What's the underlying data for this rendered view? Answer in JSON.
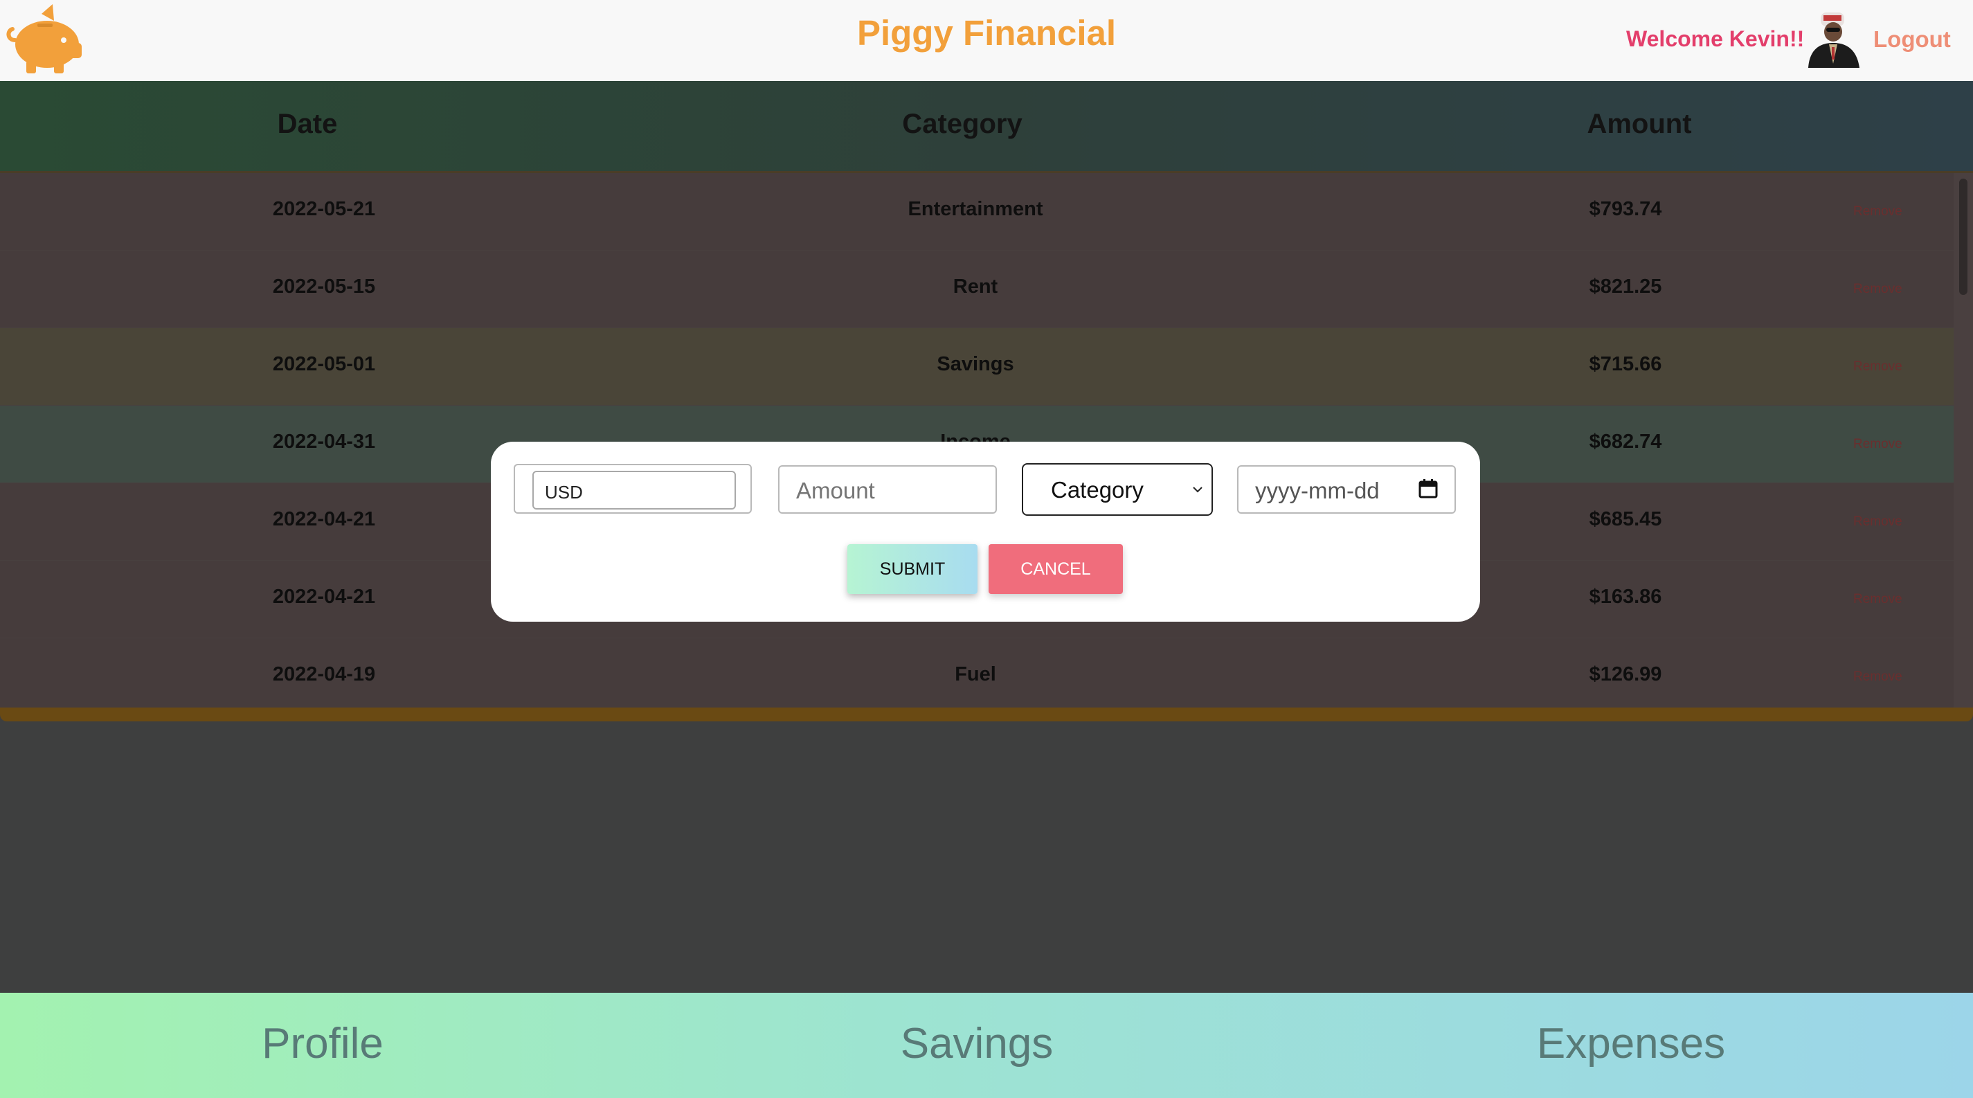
{
  "header": {
    "title": "Piggy Financial",
    "welcome": "Welcome Kevin!!",
    "logout": "Logout",
    "logo_icon": "piggy-bank-icon",
    "avatar_icon": "user-avatar"
  },
  "table": {
    "columns": [
      "Date",
      "Category",
      "Amount"
    ],
    "rows": [
      {
        "date": "2022-05-21",
        "category": "Entertainment",
        "amount": "$793.74",
        "action": "Remove",
        "color": "#463c3c"
      },
      {
        "date": "2022-05-15",
        "category": "Rent",
        "amount": "$821.25",
        "action": "Remove",
        "color": "#463c3c"
      },
      {
        "date": "2022-05-01",
        "category": "Savings",
        "amount": "$715.66",
        "action": "Remove",
        "color": "#4a4538"
      },
      {
        "date": "2022-04-31",
        "category": "Income",
        "amount": "$682.74",
        "action": "Remove",
        "color": "#3f4b44"
      },
      {
        "date": "2022-04-21",
        "category": "",
        "amount": "$685.45",
        "action": "Remove",
        "color": "#463c3c"
      },
      {
        "date": "2022-04-21",
        "category": "",
        "amount": "$163.86",
        "action": "Remove",
        "color": "#463c3c"
      },
      {
        "date": "2022-04-19",
        "category": "Fuel",
        "amount": "$126.99",
        "action": "Remove",
        "color": "#463c3c"
      }
    ]
  },
  "modal": {
    "currency_value": "USD",
    "amount_placeholder": "Amount",
    "category_selected": "Category",
    "date_placeholder": "yyyy-mm-dd",
    "submit_label": "SUBMIT",
    "cancel_label": "CANCEL"
  },
  "bottom_nav": {
    "items": [
      "Profile",
      "Savings",
      "Expenses"
    ]
  },
  "colors": {
    "brand": "#f2a03b",
    "welcome": "#e33e6b",
    "logout": "#ee8e76",
    "cancel": "#f06d7c"
  }
}
